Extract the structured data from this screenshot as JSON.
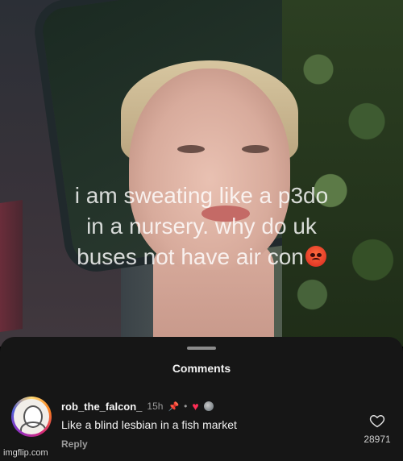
{
  "video": {
    "caption_lines": [
      "i am sweating like a p3do",
      "in a nursery. why do uk",
      "buses not have air con"
    ],
    "caption_emoji": "angry-face-icon"
  },
  "comments_sheet": {
    "title": "Comments",
    "comment": {
      "username": "rob_the_falcon_",
      "time": "15h",
      "pinned_icon": "pin-icon",
      "separator": "•",
      "liked_by_creator_icon": "heart-icon",
      "text": "Like a blind lesbian in a fish market",
      "reply_label": "Reply",
      "like_count": "28971"
    }
  },
  "watermark": "imgflip.com",
  "colors": {
    "sheet_background": "#161616",
    "heart": "#ff2d55"
  }
}
